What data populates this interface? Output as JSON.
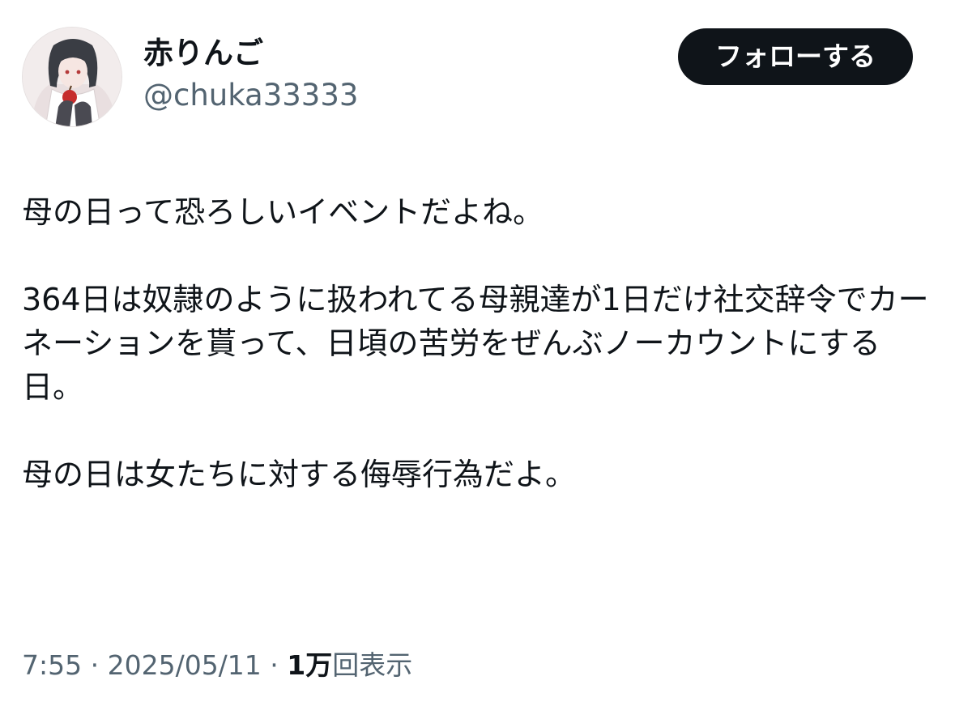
{
  "user": {
    "display_name": "赤りんご",
    "handle": "@chuka33333",
    "avatar_icon": "avatar-illustration"
  },
  "actions": {
    "follow_label": "フォローする"
  },
  "tweet": {
    "paragraphs": [
      "母の日って恐ろしいイベントだよね。",
      "364日は奴隷のように扱われてる母親達が1日だけ社交辞令でカーネーションを貰って、日頃の苦労をぜんぶノーカウントにする日。",
      "母の日は女たちに対する侮辱行為だよ。"
    ]
  },
  "meta": {
    "time": "7:55",
    "separator": "·",
    "date": "2025/05/11",
    "views_count": "1万",
    "views_label": "回表示"
  },
  "colors": {
    "text_primary": "#0f1419",
    "text_secondary": "#536471",
    "button_bg": "#0f1419",
    "button_text": "#ffffff",
    "background": "#ffffff"
  }
}
